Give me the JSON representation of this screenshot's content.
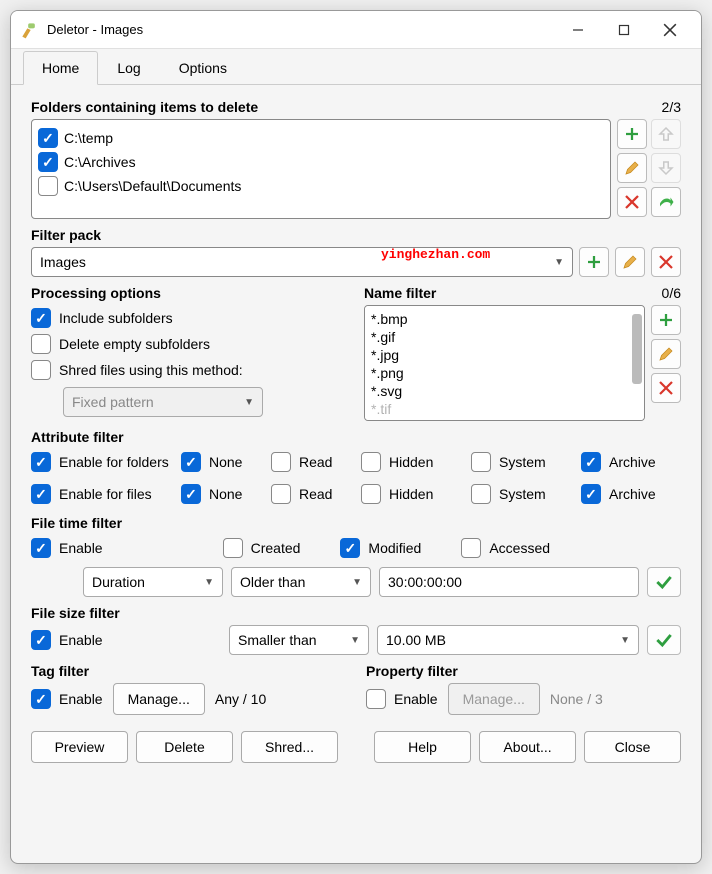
{
  "window": {
    "title": "Deletor - Images"
  },
  "tabs": {
    "home": "Home",
    "log": "Log",
    "options": "Options"
  },
  "folders": {
    "header": "Folders containing items to delete",
    "counter": "2/3",
    "items": [
      {
        "label": "C:\\temp",
        "checked": true
      },
      {
        "label": "C:\\Archives",
        "checked": true
      },
      {
        "label": "C:\\Users\\Default\\Documents",
        "checked": false
      }
    ]
  },
  "filterpack": {
    "header": "Filter pack",
    "value": "Images"
  },
  "watermark": "yinghezhan.com",
  "processing": {
    "header": "Processing options",
    "include_subfolders": "Include subfolders",
    "delete_empty": "Delete empty subfolders",
    "shred_method": "Shred files using this method:",
    "shred_value": "Fixed pattern"
  },
  "namefilter": {
    "header": "Name filter",
    "counter": "0/6",
    "items": [
      "*.bmp",
      "*.gif",
      "*.jpg",
      "*.png",
      "*.svg",
      "*.tif"
    ]
  },
  "attrfilter": {
    "header": "Attribute filter",
    "enable_folders": "Enable for folders",
    "enable_files": "Enable for files",
    "none": "None",
    "read": "Read",
    "hidden": "Hidden",
    "system": "System",
    "archive": "Archive"
  },
  "timefilter": {
    "header": "File time filter",
    "enable": "Enable",
    "created": "Created",
    "modified": "Modified",
    "accessed": "Accessed",
    "mode": "Duration",
    "op": "Older than",
    "value": "30:00:00:00"
  },
  "sizefilter": {
    "header": "File size filter",
    "enable": "Enable",
    "op": "Smaller than",
    "value": "10.00 MB"
  },
  "tagfilter": {
    "header": "Tag filter",
    "enable": "Enable",
    "manage": "Manage...",
    "count": "Any / 10"
  },
  "propfilter": {
    "header": "Property filter",
    "enable": "Enable",
    "manage": "Manage...",
    "count": "None / 3"
  },
  "buttons": {
    "preview": "Preview",
    "delete": "Delete",
    "shred": "Shred...",
    "help": "Help",
    "about": "About...",
    "close": "Close"
  }
}
